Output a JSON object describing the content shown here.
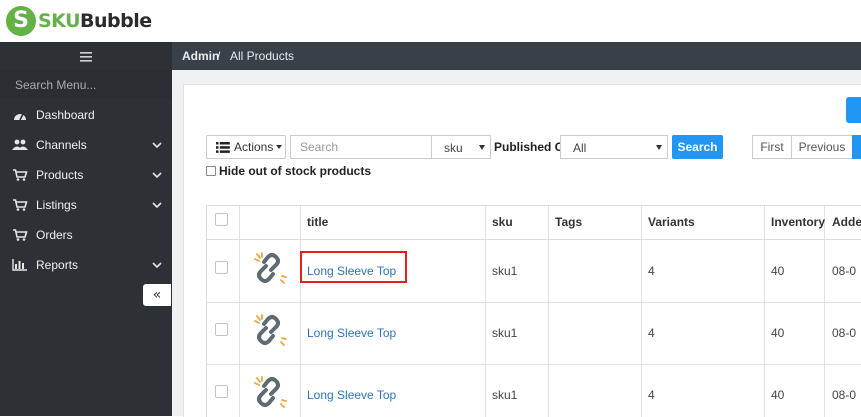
{
  "brand": {
    "name_part1": "SKU",
    "name_part2": "Bubble",
    "mark": "S",
    "color": "#62b246"
  },
  "sidebar": {
    "toggle_icon": "hamburger-icon",
    "search_placeholder": "Search Menu...",
    "items": [
      {
        "label": "Dashboard",
        "icon": "dashboard-icon",
        "expandable": false
      },
      {
        "label": "Channels",
        "icon": "users-icon",
        "expandable": true
      },
      {
        "label": "Products",
        "icon": "cart-icon",
        "expandable": true
      },
      {
        "label": "Listings",
        "icon": "cart-icon",
        "expandable": true
      },
      {
        "label": "Orders",
        "icon": "cart-icon",
        "expandable": false
      },
      {
        "label": "Reports",
        "icon": "bar-chart-icon",
        "expandable": true
      }
    ],
    "collapse_label": "«"
  },
  "breadcrumb": {
    "root": "Admin",
    "separator": "/",
    "current": "All Products"
  },
  "toolbar": {
    "actions_label": "Actions",
    "search_placeholder": "Search",
    "search_field_select": "sku",
    "published_on_label": "Published On",
    "published_on_select": "All",
    "search_button": "Search",
    "pager": {
      "first": "First",
      "previous": "Previous"
    },
    "hide_out_of_stock_label": "Hide out of stock products",
    "accent_color": "#2196f3"
  },
  "table": {
    "columns": [
      "title",
      "sku",
      "Tags",
      "Variants",
      "Inventory",
      "Adde"
    ],
    "rows": [
      {
        "title": "Long Sleeve Top",
        "sku": "sku1",
        "tags": "",
        "variants": "4",
        "inventory": "40",
        "added": "08-0"
      },
      {
        "title": "Long Sleeve Top",
        "sku": "sku1",
        "tags": "",
        "variants": "4",
        "inventory": "40",
        "added": "08-0"
      },
      {
        "title": "Long Sleeve Top",
        "sku": "sku1",
        "tags": "",
        "variants": "4",
        "inventory": "40",
        "added": "08-0"
      }
    ],
    "thumbnail_icon": "broken-link-icon",
    "highlight_color": "#e3211c"
  }
}
